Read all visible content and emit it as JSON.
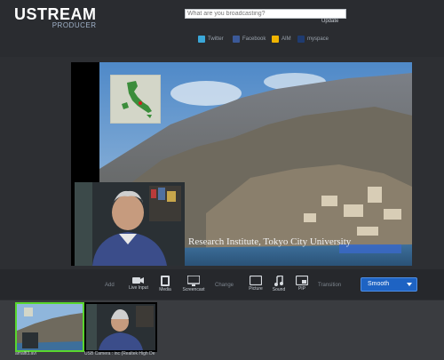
{
  "header": {
    "logo_main": "USTREAM",
    "logo_sub": "PRODUCER",
    "status_placeholder": "What are you broadcasting?",
    "update_label": "Update"
  },
  "social": [
    {
      "label": "Twitter",
      "color": "#3aa7d8",
      "icon": "twitter-icon"
    },
    {
      "label": "Facebook",
      "color": "#3b5998",
      "icon": "facebook-icon"
    },
    {
      "label": "AIM",
      "color": "#f0b400",
      "icon": "aim-icon"
    },
    {
      "label": "myspace",
      "color": "#1f3b70",
      "icon": "myspace-icon"
    }
  ],
  "stage": {
    "caption": "Research Institute, Tokyo City University"
  },
  "controls": {
    "add_label": "Add",
    "change_label": "Change",
    "transition_label": "Transition",
    "add_buttons": [
      {
        "label": "Live Input",
        "icon": "camera-icon"
      },
      {
        "label": "Media",
        "icon": "film-icon"
      },
      {
        "label": "Screencast",
        "icon": "monitor-icon"
      }
    ],
    "change_buttons": [
      {
        "label": "Picture",
        "icon": "picture-icon"
      },
      {
        "label": "Sound",
        "icon": "music-note-icon"
      },
      {
        "label": "PIP",
        "icon": "pip-icon"
      }
    ],
    "transition_value": "Smooth"
  },
  "sources": [
    {
      "label": "amalfi3.avi",
      "selected": true
    },
    {
      "label": "USB Camera : inc (Realtek High De",
      "selected": false
    }
  ],
  "colors": {
    "accent": "#1e63c3",
    "selected_border": "#59d62d",
    "background": "#2d2f33"
  }
}
